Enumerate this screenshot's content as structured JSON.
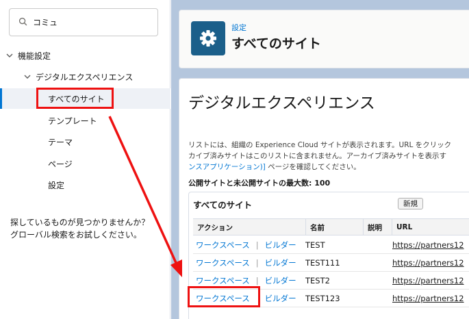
{
  "search": {
    "value": "コミュ"
  },
  "tree": {
    "section": "機能設定",
    "group": "デジタルエクスペリエンス",
    "items": [
      {
        "label": "すべてのサイト",
        "selected": true
      },
      {
        "label": "テンプレート"
      },
      {
        "label": "テーマ"
      },
      {
        "label": "ページ"
      },
      {
        "label": "設定"
      }
    ]
  },
  "help": {
    "line1": "探しているものが見つかりませんか？",
    "line2": "グローバル検索をお試しください。"
  },
  "header": {
    "eyebrow": "設定",
    "title": "すべてのサイト"
  },
  "content": {
    "title": "デジタルエクスペリエンス",
    "desc_line1": "リストには、組織の Experience Cloud サイトが表示されます。URL をクリック",
    "desc_line2": "カイブ済みサイトはこのリストに含まれません。アーカイブ済みサイトを表示す",
    "desc_line3_link": "ンスアプリケーション)]",
    "desc_line3_rest": " ページを確認してください。",
    "max_line": "公開サイトと未公開サイトの最大数: 100"
  },
  "sites": {
    "title": "すべてのサイト",
    "new_button": "新規",
    "columns": [
      "アクション",
      "名前",
      "説明",
      "URL"
    ],
    "workspace_label": "ワークスペース",
    "builder_label": "ビルダー",
    "separator": "|",
    "rows": [
      {
        "name": "TEST",
        "description": "",
        "url": "https://partners12"
      },
      {
        "name": "TEST111",
        "description": "",
        "url": "https://partners12"
      },
      {
        "name": "TEST2",
        "description": "",
        "url": "https://partners12"
      },
      {
        "name": "TEST123",
        "description": "",
        "url": "https://partners12"
      }
    ]
  },
  "colors": {
    "accent": "#0176d3",
    "annotation": "#ee1111",
    "header_icon": "#1b5f8a",
    "page_bg": "#b4c6dd"
  }
}
